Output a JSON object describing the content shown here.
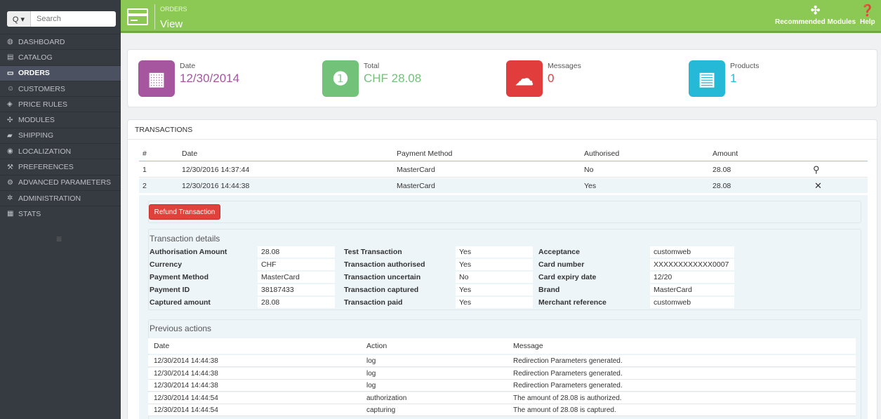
{
  "sidebar": {
    "search_placeholder": "Search",
    "search_btn": "Q ▾",
    "items": [
      {
        "label": "DASHBOARD",
        "icon": "dashboard-icon",
        "glyph": "◍"
      },
      {
        "label": "CATALOG",
        "icon": "catalog-icon",
        "glyph": "▤"
      },
      {
        "label": "ORDERS",
        "icon": "orders-icon",
        "glyph": "▭"
      },
      {
        "label": "CUSTOMERS",
        "icon": "customers-icon",
        "glyph": "☺"
      },
      {
        "label": "PRICE RULES",
        "icon": "tag-icon",
        "glyph": "◈"
      },
      {
        "label": "MODULES",
        "icon": "puzzle-icon",
        "glyph": "✣"
      },
      {
        "label": "SHIPPING",
        "icon": "truck-icon",
        "glyph": "▰"
      },
      {
        "label": "LOCALIZATION",
        "icon": "globe-icon",
        "glyph": "◉"
      },
      {
        "label": "PREFERENCES",
        "icon": "wrench-icon",
        "glyph": "⚒"
      },
      {
        "label": "ADVANCED PARAMETERS",
        "icon": "cogs-icon",
        "glyph": "⚙"
      },
      {
        "label": "ADMINISTRATION",
        "icon": "cog-icon",
        "glyph": "✲"
      },
      {
        "label": "STATS",
        "icon": "chart-icon",
        "glyph": "▦"
      }
    ],
    "active_index": 2,
    "collapse_glyph": "≡"
  },
  "header": {
    "breadcrumb": "ORDERS",
    "title": "View",
    "recommended_modules": "Recommended Modules",
    "help": "Help",
    "recommended_glyph": "✣",
    "help_glyph": "❓"
  },
  "kpis": [
    {
      "label": "Date",
      "value": "12/30/2014",
      "color": "#a5569f",
      "icon": "calendar-icon",
      "glyph": "▦"
    },
    {
      "label": "Total",
      "value": "CHF 28.08",
      "color": "#72c279",
      "icon": "money-icon",
      "glyph": "❶"
    },
    {
      "label": "Messages",
      "value": "0",
      "color": "#e23d3d",
      "icon": "chat-icon",
      "glyph": "☁"
    },
    {
      "label": "Products",
      "value": "1",
      "color": "#25b9d7",
      "icon": "book-icon",
      "glyph": "▤"
    }
  ],
  "transactions": {
    "heading": "TRANSACTIONS",
    "columns": [
      "#",
      "Date",
      "Payment Method",
      "Authorised",
      "Amount"
    ],
    "rows": [
      {
        "num": "1",
        "date": "12/30/2016 14:37:44",
        "method": "MasterCard",
        "authorised": "No",
        "amount": "28.08",
        "action_glyph": "⚲"
      },
      {
        "num": "2",
        "date": "12/30/2016 14:44:38",
        "method": "MasterCard",
        "authorised": "Yes",
        "amount": "28.08",
        "action_glyph": "✕"
      }
    ],
    "refund_label": "Refund Transaction",
    "details_title": "Transaction details",
    "details": [
      [
        {
          "label": "Authorisation Amount",
          "value": "28.08"
        },
        {
          "label": "Currency",
          "value": "CHF"
        },
        {
          "label": "Payment Method",
          "value": "MasterCard"
        },
        {
          "label": "Payment ID",
          "value": "38187433"
        },
        {
          "label": "Captured amount",
          "value": "28.08"
        }
      ],
      [
        {
          "label": "Test Transaction",
          "value": "Yes"
        },
        {
          "label": "Transaction authorised",
          "value": "Yes"
        },
        {
          "label": "Transaction uncertain",
          "value": "No"
        },
        {
          "label": "Transaction captured",
          "value": "Yes"
        },
        {
          "label": "Transaction paid",
          "value": "Yes"
        }
      ],
      [
        {
          "label": "Acceptance",
          "value": "customweb"
        },
        {
          "label": "Card number",
          "value": "XXXXXXXXXXXX0007"
        },
        {
          "label": "Card expiry date",
          "value": "12/20"
        },
        {
          "label": "Brand",
          "value": "MasterCard"
        },
        {
          "label": "Merchant reference",
          "value": "customweb"
        }
      ]
    ],
    "previous_title": "Previous actions",
    "previous_columns": [
      "Date",
      "Action",
      "Message"
    ],
    "previous_rows": [
      {
        "date": "12/30/2014 14:44:38",
        "action": "log",
        "message": "Redirection Parameters generated."
      },
      {
        "date": "12/30/2014 14:44:38",
        "action": "log",
        "message": "Redirection Parameters generated."
      },
      {
        "date": "12/30/2014 14:44:38",
        "action": "log",
        "message": "Redirection Parameters generated."
      },
      {
        "date": "12/30/2014 14:44:54",
        "action": "authorization",
        "message": "The amount of 28.08 is authorized."
      },
      {
        "date": "12/30/2014 14:44:54",
        "action": "capturing",
        "message": "The amount of 28.08 is captured."
      }
    ]
  }
}
